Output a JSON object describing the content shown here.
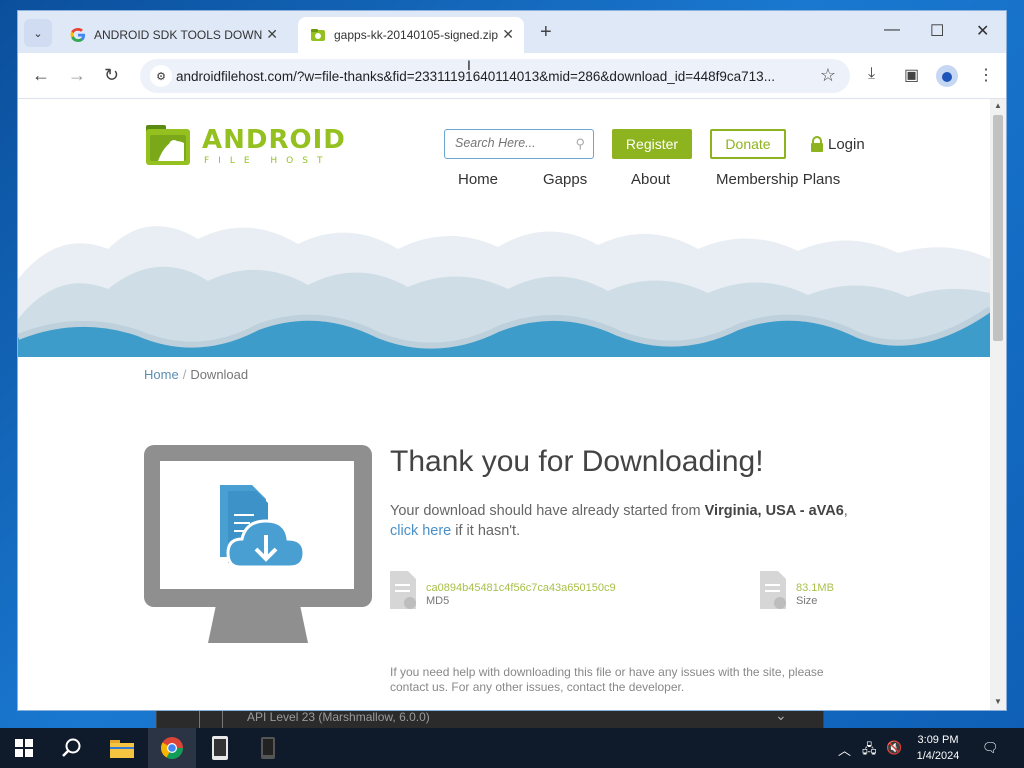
{
  "browser": {
    "tabs": [
      {
        "label": "ANDROID SDK TOOLS DOWNLOAD",
        "active": false
      },
      {
        "label": "gapps-kk-20140105-signed.zip",
        "active": true
      }
    ],
    "url": "androidfilehost.com/?w=file-thanks&fid=23311191640114013&mid=286&download_id=448f9ca713..."
  },
  "site": {
    "logo": {
      "line1": "ANDROID",
      "line2": "FILE HOST"
    },
    "search_placeholder": "Search Here...",
    "register": "Register",
    "donate": "Donate",
    "login": "Login",
    "menu": [
      "Home",
      "Gapps",
      "About",
      "Membership Plans"
    ],
    "breadcrumb": {
      "home": "Home",
      "sep": "/",
      "current": "Download"
    }
  },
  "download": {
    "title": "Thank you for Downloading!",
    "msg_prefix": "Your download should have already started from ",
    "location": "Virginia, USA - aVA6",
    "msg_comma": ", ",
    "link": "click here",
    "msg_suffix": " if it hasn't.",
    "md5_value": "ca0894b45481c4f56c7ca43a650150c9",
    "md5_label": "MD5",
    "size_value": "83.1MB",
    "size_label": "Size",
    "help": "If you need help with downloading this file or have any issues with the site, please contact us. For any other issues, contact the developer."
  },
  "background_window": {
    "text": "API Level 23 (Marshmallow, 6.0.0)"
  },
  "taskbar": {
    "time": "3:09 PM",
    "date": "1/4/2024"
  },
  "colors": {
    "accent_green": "#8db31e",
    "wave_blue": "#3d9cc9",
    "taskbar": "#0f1a2a"
  }
}
